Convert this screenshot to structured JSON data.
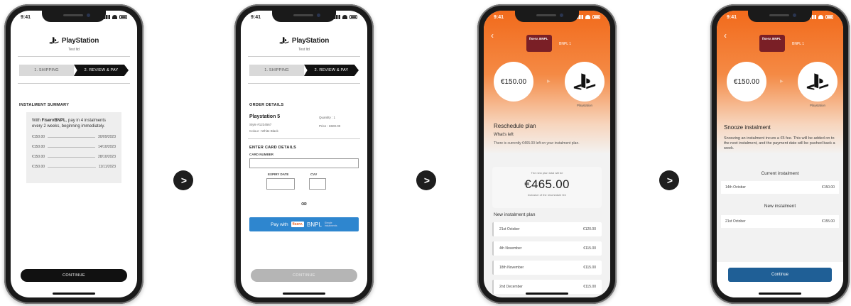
{
  "status_time": "9:41",
  "brand": {
    "name": "PlayStation",
    "subtitle": "Test ltd"
  },
  "steps": {
    "step1": "1. SHIPPING",
    "step2": "2. REVIEW & PAY"
  },
  "screen1": {
    "section_title": "INSTALMENT SUMMARY",
    "intro_prefix": "With ",
    "intro_brand": "FiservBNPL",
    "intro_suffix": ", pay in 4 instalments every 2 weeks, beginning immediately.",
    "instalments": [
      {
        "amount": "€150.00",
        "date": "30/09/2023"
      },
      {
        "amount": "€150.00",
        "date": "14/10/2023"
      },
      {
        "amount": "€150.00",
        "date": "28/10/2023"
      },
      {
        "amount": "€150.00",
        "date": "11/11/2023"
      }
    ],
    "continue_label": "CONTINUE"
  },
  "screen2": {
    "order_title": "ORDER DETAILS",
    "product": "Playstation 5",
    "style": "Style #1234567",
    "colour": "Colour : White Black",
    "quantity": "Quantity : 1",
    "price": "Price : €600.00",
    "card_title": "ENTER CARD DETAILS",
    "card_number_label": "CARD NUMBER",
    "expiry_label": "EXPIRY DATE",
    "cvv_label": "CVV",
    "or_label": "OR",
    "pay_with": "Pay with",
    "pay_brand": "fiserv.",
    "pay_bnpl": "BNPL",
    "pay_small": "Simple instalments",
    "continue_label": "CONTINUE"
  },
  "screen3": {
    "card_label": "BNPL 1",
    "card_brand": "fiserv. BNPL",
    "amount": "€150.00",
    "merchant": "Playstation",
    "title": "Reschedule plan",
    "subtitle": "What's left",
    "body": "There is currently €465.00 left on your instalment plan.",
    "total_label": "The new plan total will be",
    "total": "€465.00",
    "total_note": "Inclusive of the reschedule fee",
    "plan_head": "New instalment plan",
    "plan": [
      {
        "date": "21st October",
        "amount": "€120.00"
      },
      {
        "date": "4th November",
        "amount": "€115.00"
      },
      {
        "date": "18th November",
        "amount": "€115.00"
      },
      {
        "date": "2nd December",
        "amount": "€115.00"
      }
    ]
  },
  "screen4": {
    "card_label": "BNPL 1",
    "card_brand": "fiserv. BNPL",
    "amount": "€150.00",
    "merchant": "Playstation",
    "title": "Snooze instalment",
    "body": "Snoozing an instalment incurs a €5 fee. This will be added on to the next instalment, and the payment date will be pushed back a week.",
    "current_label": "Current instalment",
    "current": {
      "date": "14th October",
      "amount": "€150.00"
    },
    "new_label": "New instalment",
    "new": {
      "date": "21st October",
      "amount": "€155.00"
    },
    "continue_label": "Continue"
  },
  "nav": {
    "chevron": ">"
  }
}
